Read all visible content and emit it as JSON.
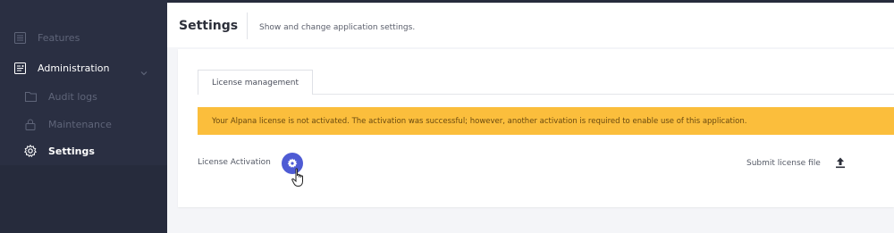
{
  "sidebar": {
    "items": [
      {
        "label": "Features",
        "icon": "list-icon"
      },
      {
        "label": "Administration",
        "icon": "admin-panel-icon"
      },
      {
        "label": "Audit logs",
        "icon": "folder-icon"
      },
      {
        "label": "Maintenance",
        "icon": "lock-icon"
      },
      {
        "label": "Settings",
        "icon": "gear-icon"
      }
    ]
  },
  "header": {
    "title": "Settings",
    "description": "Show and change application settings."
  },
  "card": {
    "tab_label": "License management",
    "alert_text": "Your Alpana license is not activated. The activation was successful; however, another activation is required to enable use of this application.",
    "license_activation_label": "License Activation",
    "submit_label": "Submit license file"
  },
  "colors": {
    "sidebar_bg": "#262b3c",
    "accent": "#4e5bd4",
    "alert_bg": "#fbbe3c"
  }
}
